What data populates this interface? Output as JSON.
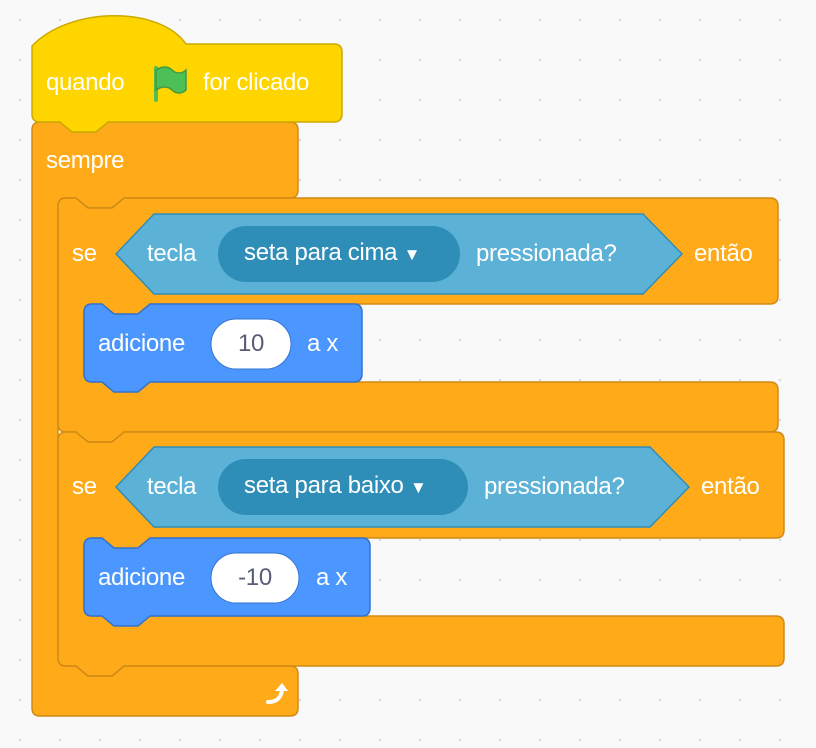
{
  "colors": {
    "event_fill": "#ffd500",
    "event_stroke": "#ccaa00",
    "control_fill": "#ffab19",
    "control_stroke": "#cf8b17",
    "sensing_fill": "#5cb1d6",
    "sensing_stroke": "#2e8eb8",
    "menu_fill": "#2e8eb8",
    "motion_fill": "#4c97ff",
    "motion_stroke": "#3373cc",
    "flag_green": "#4cbf56"
  },
  "hat_block": {
    "label_when": "quando",
    "flag_icon": "green-flag-icon",
    "label_clicked": "for clicado"
  },
  "forever_block": {
    "label": "sempre",
    "loop_icon": "loop-arrow-icon"
  },
  "if_blocks": [
    {
      "label_if": "se",
      "sensing": {
        "label_key": "tecla",
        "key_option": "seta para cima",
        "label_pressed": "pressionada?"
      },
      "label_then": "então",
      "change_x": {
        "label_change": "adicione",
        "value": "10",
        "label_to_x": "a x"
      }
    },
    {
      "label_if": "se",
      "sensing": {
        "label_key": "tecla",
        "key_option": "seta para baixo",
        "label_pressed": "pressionada?"
      },
      "label_then": "então",
      "change_x": {
        "label_change": "adicione",
        "value": "-10",
        "label_to_x": "a x"
      }
    }
  ]
}
